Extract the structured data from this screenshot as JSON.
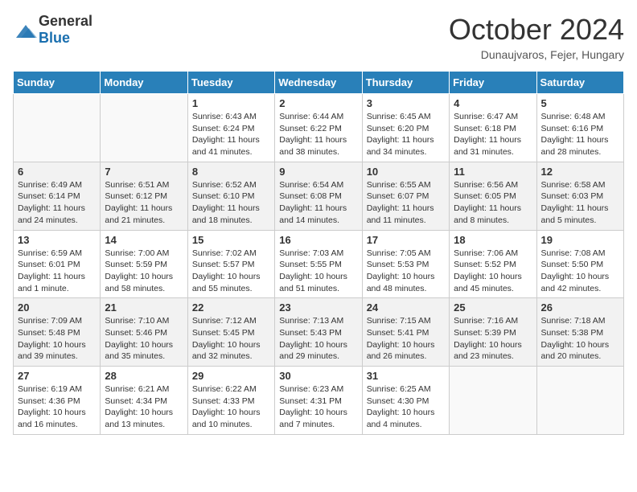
{
  "header": {
    "logo": {
      "general": "General",
      "blue": "Blue"
    },
    "title": "October 2024",
    "location": "Dunaujvaros, Fejer, Hungary"
  },
  "columns": [
    "Sunday",
    "Monday",
    "Tuesday",
    "Wednesday",
    "Thursday",
    "Friday",
    "Saturday"
  ],
  "weeks": [
    [
      {
        "day": "",
        "detail": ""
      },
      {
        "day": "",
        "detail": ""
      },
      {
        "day": "1",
        "detail": "Sunrise: 6:43 AM\nSunset: 6:24 PM\nDaylight: 11 hours and 41 minutes."
      },
      {
        "day": "2",
        "detail": "Sunrise: 6:44 AM\nSunset: 6:22 PM\nDaylight: 11 hours and 38 minutes."
      },
      {
        "day": "3",
        "detail": "Sunrise: 6:45 AM\nSunset: 6:20 PM\nDaylight: 11 hours and 34 minutes."
      },
      {
        "day": "4",
        "detail": "Sunrise: 6:47 AM\nSunset: 6:18 PM\nDaylight: 11 hours and 31 minutes."
      },
      {
        "day": "5",
        "detail": "Sunrise: 6:48 AM\nSunset: 6:16 PM\nDaylight: 11 hours and 28 minutes."
      }
    ],
    [
      {
        "day": "6",
        "detail": "Sunrise: 6:49 AM\nSunset: 6:14 PM\nDaylight: 11 hours and 24 minutes."
      },
      {
        "day": "7",
        "detail": "Sunrise: 6:51 AM\nSunset: 6:12 PM\nDaylight: 11 hours and 21 minutes."
      },
      {
        "day": "8",
        "detail": "Sunrise: 6:52 AM\nSunset: 6:10 PM\nDaylight: 11 hours and 18 minutes."
      },
      {
        "day": "9",
        "detail": "Sunrise: 6:54 AM\nSunset: 6:08 PM\nDaylight: 11 hours and 14 minutes."
      },
      {
        "day": "10",
        "detail": "Sunrise: 6:55 AM\nSunset: 6:07 PM\nDaylight: 11 hours and 11 minutes."
      },
      {
        "day": "11",
        "detail": "Sunrise: 6:56 AM\nSunset: 6:05 PM\nDaylight: 11 hours and 8 minutes."
      },
      {
        "day": "12",
        "detail": "Sunrise: 6:58 AM\nSunset: 6:03 PM\nDaylight: 11 hours and 5 minutes."
      }
    ],
    [
      {
        "day": "13",
        "detail": "Sunrise: 6:59 AM\nSunset: 6:01 PM\nDaylight: 11 hours and 1 minute."
      },
      {
        "day": "14",
        "detail": "Sunrise: 7:00 AM\nSunset: 5:59 PM\nDaylight: 10 hours and 58 minutes."
      },
      {
        "day": "15",
        "detail": "Sunrise: 7:02 AM\nSunset: 5:57 PM\nDaylight: 10 hours and 55 minutes."
      },
      {
        "day": "16",
        "detail": "Sunrise: 7:03 AM\nSunset: 5:55 PM\nDaylight: 10 hours and 51 minutes."
      },
      {
        "day": "17",
        "detail": "Sunrise: 7:05 AM\nSunset: 5:53 PM\nDaylight: 10 hours and 48 minutes."
      },
      {
        "day": "18",
        "detail": "Sunrise: 7:06 AM\nSunset: 5:52 PM\nDaylight: 10 hours and 45 minutes."
      },
      {
        "day": "19",
        "detail": "Sunrise: 7:08 AM\nSunset: 5:50 PM\nDaylight: 10 hours and 42 minutes."
      }
    ],
    [
      {
        "day": "20",
        "detail": "Sunrise: 7:09 AM\nSunset: 5:48 PM\nDaylight: 10 hours and 39 minutes."
      },
      {
        "day": "21",
        "detail": "Sunrise: 7:10 AM\nSunset: 5:46 PM\nDaylight: 10 hours and 35 minutes."
      },
      {
        "day": "22",
        "detail": "Sunrise: 7:12 AM\nSunset: 5:45 PM\nDaylight: 10 hours and 32 minutes."
      },
      {
        "day": "23",
        "detail": "Sunrise: 7:13 AM\nSunset: 5:43 PM\nDaylight: 10 hours and 29 minutes."
      },
      {
        "day": "24",
        "detail": "Sunrise: 7:15 AM\nSunset: 5:41 PM\nDaylight: 10 hours and 26 minutes."
      },
      {
        "day": "25",
        "detail": "Sunrise: 7:16 AM\nSunset: 5:39 PM\nDaylight: 10 hours and 23 minutes."
      },
      {
        "day": "26",
        "detail": "Sunrise: 7:18 AM\nSunset: 5:38 PM\nDaylight: 10 hours and 20 minutes."
      }
    ],
    [
      {
        "day": "27",
        "detail": "Sunrise: 6:19 AM\nSunset: 4:36 PM\nDaylight: 10 hours and 16 minutes."
      },
      {
        "day": "28",
        "detail": "Sunrise: 6:21 AM\nSunset: 4:34 PM\nDaylight: 10 hours and 13 minutes."
      },
      {
        "day": "29",
        "detail": "Sunrise: 6:22 AM\nSunset: 4:33 PM\nDaylight: 10 hours and 10 minutes."
      },
      {
        "day": "30",
        "detail": "Sunrise: 6:23 AM\nSunset: 4:31 PM\nDaylight: 10 hours and 7 minutes."
      },
      {
        "day": "31",
        "detail": "Sunrise: 6:25 AM\nSunset: 4:30 PM\nDaylight: 10 hours and 4 minutes."
      },
      {
        "day": "",
        "detail": ""
      },
      {
        "day": "",
        "detail": ""
      }
    ]
  ]
}
